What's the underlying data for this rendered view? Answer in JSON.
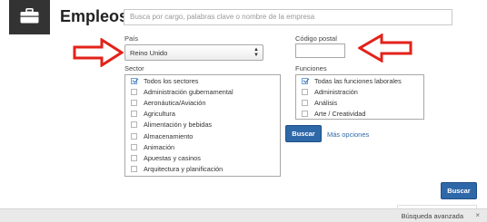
{
  "header": {
    "icon": "briefcase-icon",
    "title": "Empleos",
    "search_placeholder": "Busca por cargo, palabras clave o nombre de la empresa"
  },
  "filters": {
    "pais_label": "País",
    "pais_value": "Reino Unido",
    "cp_label": "Código postal",
    "cp_value": "",
    "sector_label": "Sector",
    "sector_items": [
      {
        "label": "Todos los sectores",
        "checked": true
      },
      {
        "label": "Administración gubernamental",
        "checked": false
      },
      {
        "label": "Aeronáutica/Aviación",
        "checked": false
      },
      {
        "label": "Agricultura",
        "checked": false
      },
      {
        "label": "Alimentación y bebidas",
        "checked": false
      },
      {
        "label": "Almacenamiento",
        "checked": false
      },
      {
        "label": "Animación",
        "checked": false
      },
      {
        "label": "Apuestas y casinos",
        "checked": false
      },
      {
        "label": "Arquitectura y planificación",
        "checked": false
      }
    ],
    "funciones_label": "Funciones",
    "funciones_items": [
      {
        "label": "Todas las funciones laborales",
        "checked": true
      },
      {
        "label": "Administración",
        "checked": false
      },
      {
        "label": "Análisis",
        "checked": false
      },
      {
        "label": "Arte / Creatividad",
        "checked": false
      }
    ]
  },
  "actions": {
    "buscar_label": "Buscar",
    "mas_opciones_label": "Más opciones",
    "buscar_bottom_label": "Buscar"
  },
  "footer": {
    "advanced_label": "Búsqueda avanzada",
    "close_symbol": "×"
  },
  "colors": {
    "accent": "#2f68a8",
    "annotation_arrow": "#e32219"
  }
}
